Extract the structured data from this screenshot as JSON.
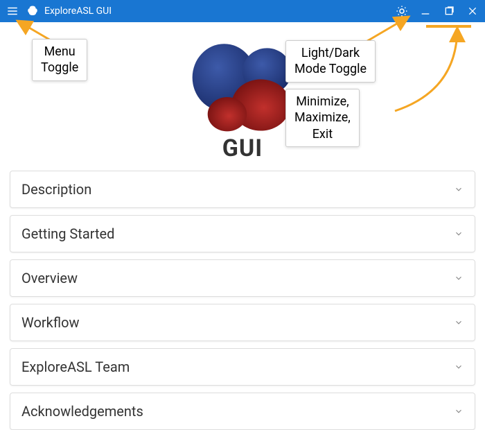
{
  "titlebar": {
    "app_title": "ExploreASL GUI"
  },
  "logo": {
    "text": "GUI"
  },
  "accordion": {
    "items": [
      {
        "label": "Description"
      },
      {
        "label": "Getting Started"
      },
      {
        "label": "Overview"
      },
      {
        "label": "Workflow"
      },
      {
        "label": "ExploreASL Team"
      },
      {
        "label": "Acknowledgements"
      }
    ]
  },
  "callouts": {
    "menu_toggle": "Menu\nToggle",
    "theme_toggle": "Light/Dark\nMode Toggle",
    "window_controls": "Minimize,\nMaximize,\nExit"
  },
  "colors": {
    "primary": "#1976d2",
    "annotation": "#f5a623"
  }
}
